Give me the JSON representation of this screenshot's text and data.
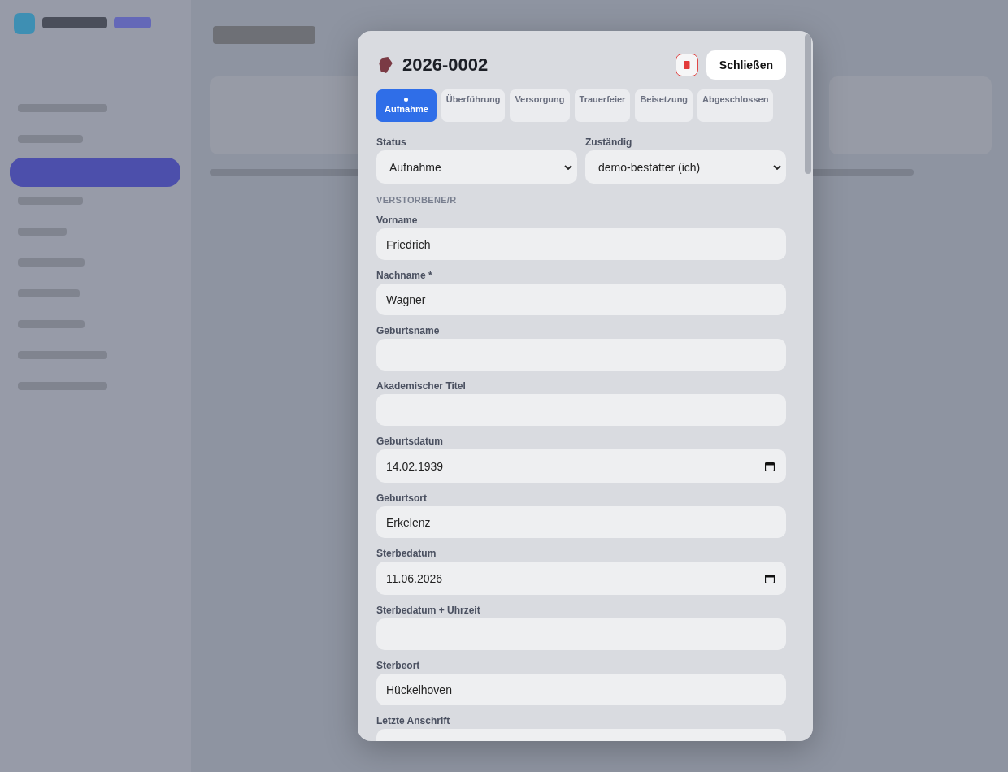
{
  "modal": {
    "title": "2026-0002",
    "close_label": "Schließen",
    "tabs": [
      {
        "label": "Aufnahme",
        "selected": true
      },
      {
        "label": "Überführung",
        "selected": false
      },
      {
        "label": "Versorgung",
        "selected": false
      },
      {
        "label": "Trauerfeier",
        "selected": false
      },
      {
        "label": "Beisetzung",
        "selected": false
      },
      {
        "label": "Abgeschlossen",
        "selected": false
      }
    ],
    "selects": [
      {
        "label": "Status",
        "value": "Aufnahme"
      },
      {
        "label": "Zuständig",
        "value": "demo-bestatter (ich)"
      }
    ],
    "section": "VERSTORBENE/R",
    "fields": [
      {
        "label": "Vorname",
        "kind": "text",
        "value": "Friedrich"
      },
      {
        "label": "Nachname *",
        "kind": "text",
        "value": "Wagner"
      },
      {
        "label": "Geburtsname",
        "kind": "text"
      },
      {
        "label": "Akademischer Titel",
        "kind": "text"
      },
      {
        "label": "Geburtsdatum",
        "kind": "date",
        "value": "14.02.1939"
      },
      {
        "label": "Geburtsort",
        "kind": "text",
        "value": "Erkelenz"
      },
      {
        "label": "Sterbedatum",
        "kind": "date",
        "value": "11.06.2026"
      },
      {
        "label": "Sterbedatum + Uhrzeit",
        "kind": "text"
      },
      {
        "label": "Sterbeort",
        "kind": "text",
        "value": "Hückelhoven"
      },
      {
        "label": "Letzte Anschrift",
        "kind": "text"
      }
    ]
  }
}
